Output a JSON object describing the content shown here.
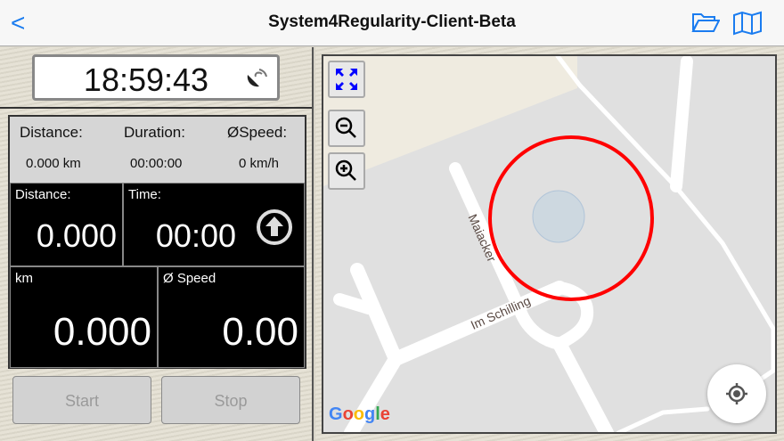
{
  "header": {
    "title": "System4Regularity-Client-Beta",
    "back": "<"
  },
  "clock": {
    "time": "18:59:43"
  },
  "summary": {
    "distance_label": "Distance:",
    "duration_label": "Duration:",
    "speed_label": "ØSpeed:",
    "distance": "0.000 km",
    "duration": "00:00:00",
    "speed": "0 km/h"
  },
  "cells": {
    "distance_label": "Distance:",
    "distance": "0.000",
    "time_label": "Time:",
    "time": "00:00",
    "km_label": "km",
    "km": "0.000",
    "speed_label": "Ø Speed",
    "speed": "0.00"
  },
  "buttons": {
    "start": "Start",
    "stop": "Stop"
  },
  "map": {
    "streets": [
      "Maiacker",
      "Im Schilling"
    ],
    "logo": [
      "G",
      "o",
      "o",
      "g",
      "l",
      "e"
    ],
    "logo_colors": [
      "#4285f4",
      "#ea4335",
      "#fbbc05",
      "#4285f4",
      "#34a853",
      "#ea4335"
    ]
  }
}
